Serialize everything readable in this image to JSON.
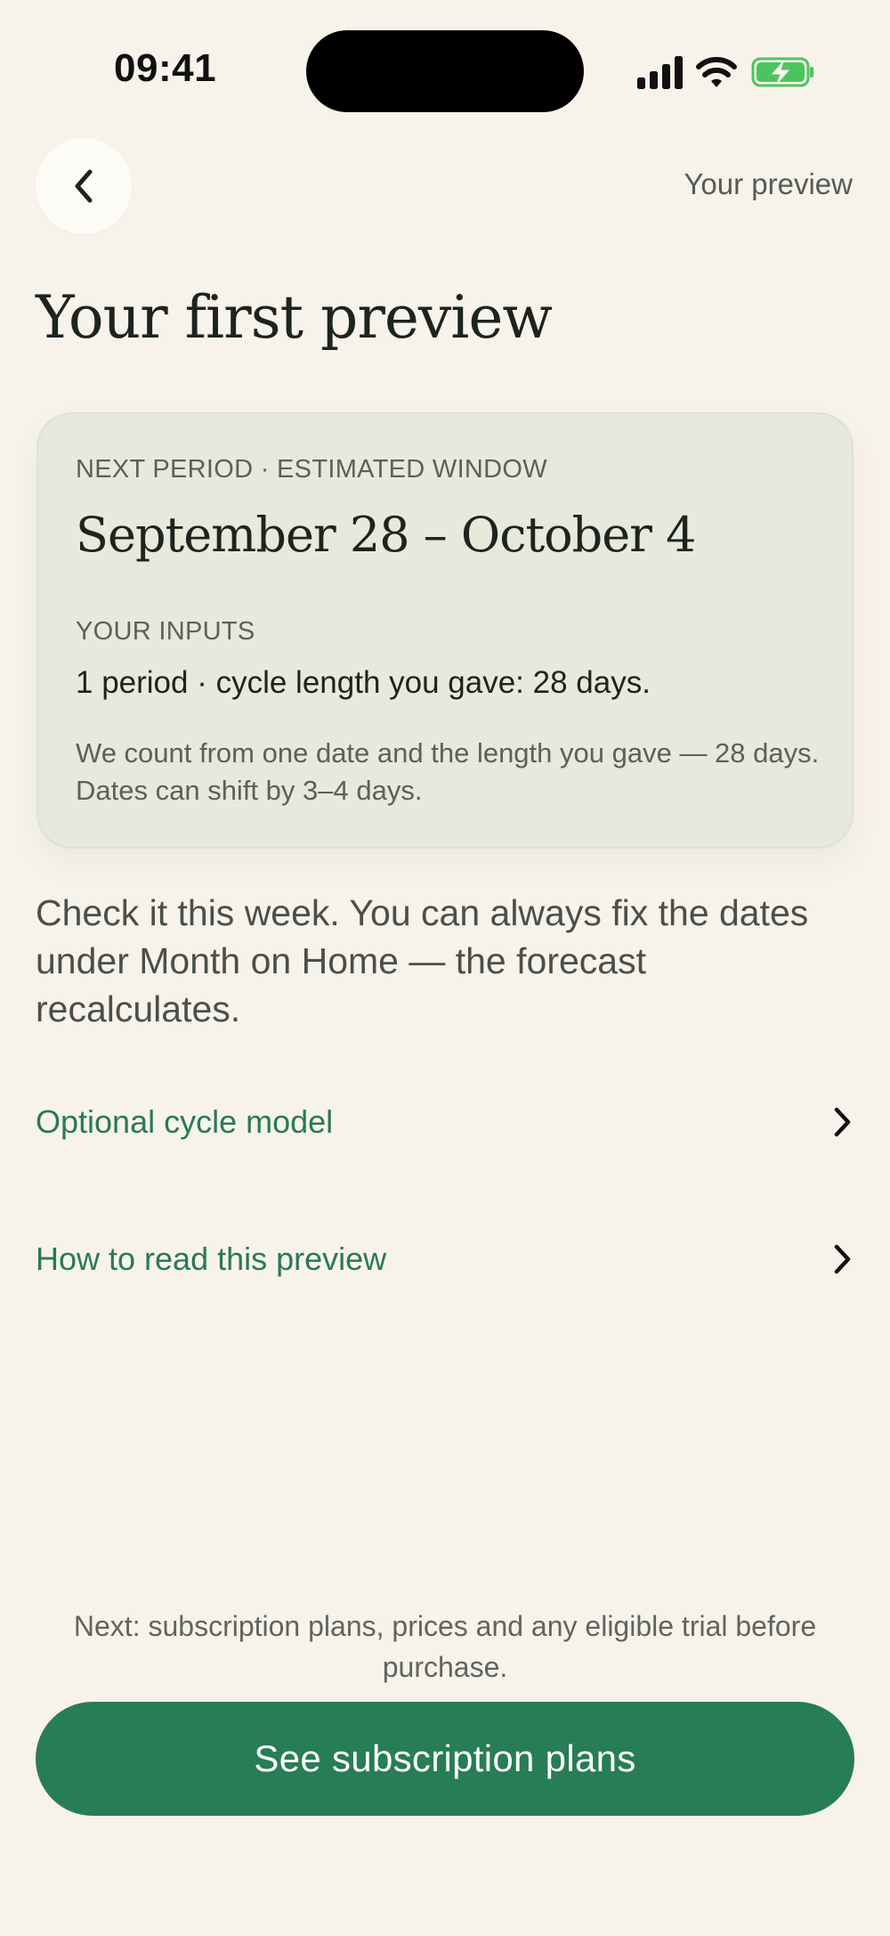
{
  "status_bar": {
    "time": "09:41",
    "icons": [
      "signal-icon",
      "wifi-icon",
      "battery-charging-icon"
    ],
    "battery_color": "#4cc45e"
  },
  "header": {
    "back_icon": "chevron-left-icon",
    "label": "Your preview"
  },
  "page": {
    "title": "Your first preview"
  },
  "card": {
    "eyebrow": "NEXT PERIOD · ESTIMATED WINDOW",
    "dates": "September 28 – October 4",
    "inputs_label": "YOUR INPUTS",
    "inputs_value": "1 period · cycle length you gave: 28 days.",
    "note": "We count from one date and the length you gave — 28 days. Dates can shift by 3–4 days."
  },
  "body_text": "Check it this week. You can always fix the dates under Month on Home — the forecast recalculates.",
  "links": [
    {
      "label": "Optional cycle model",
      "icon": "chevron-right-icon"
    },
    {
      "label": "How to read this preview",
      "icon": "chevron-right-icon"
    }
  ],
  "footer": {
    "note": "Next: subscription plans, prices and any eligible trial before purchase.",
    "cta_label": "See subscription plans"
  },
  "colors": {
    "background": "#f7f3ea",
    "accent": "#277d55",
    "link": "#2a7a50",
    "card": "#e6e9dc"
  }
}
